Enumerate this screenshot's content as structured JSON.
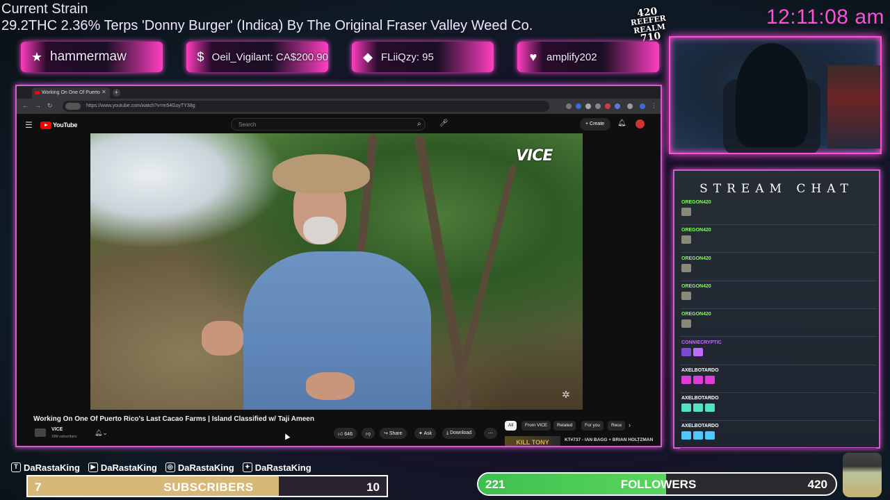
{
  "header": {
    "strain_title": "Current Strain",
    "strain_text": "29.2THC 2.36% Terps 'Donny Burger' (Indica) By The Original Fraser Valley Weed Co.",
    "clock": "12:11:08 am",
    "logo_text": "420 Reefer Realm 710"
  },
  "alerts": [
    {
      "icon": "star-icon",
      "glyph": "★",
      "text": "hammermaw"
    },
    {
      "icon": "dollar-icon",
      "glyph": "$",
      "text": "Oeil_Vigilant: CA$200.90"
    },
    {
      "icon": "diamond-icon",
      "glyph": "◆",
      "text": "FLiiQzy: 95"
    },
    {
      "icon": "heart-icon",
      "glyph": "♥",
      "text": "amplify202"
    }
  ],
  "browser": {
    "tab_title": "Working On One Of Puerto",
    "url": "https://www.youtube.com/watch?v=m54GoyTY38g",
    "yt_wordmark": "YouTube",
    "search_placeholder": "Search",
    "create_label": "+ Create",
    "watermark": "VICE",
    "video_title": "Working On One Of Puerto Rico's Last Cacao Farms | Island Classified w/ Taji Ameen",
    "channel_name": "VICE",
    "channel_subs": "18M subscribers",
    "likes": "646",
    "share_label": "Share",
    "ask_label": "Ask",
    "download_label": "Download",
    "chips": [
      {
        "label": "All",
        "active": true
      },
      {
        "label": "From VICE",
        "active": false
      },
      {
        "label": "Related",
        "active": false
      },
      {
        "label": "For you",
        "active": false
      },
      {
        "label": "Rece",
        "active": false
      }
    ],
    "rec_thumb_text": "KILL TONY",
    "rec_title": "KT#737 - IAN BAGG + BRIAN HOLTZMAN"
  },
  "chat": {
    "title": "STREAM CHAT",
    "messages": [
      {
        "user": "OREGON420",
        "color": "#7fff5a",
        "emotes": 1
      },
      {
        "user": "OREGON420",
        "color": "#7fff5a",
        "emotes": 1
      },
      {
        "user": "OREGON420",
        "color": "#7fff5a",
        "emotes": 1
      },
      {
        "user": "OREGON420",
        "color": "#7fff5a",
        "emotes": 1
      },
      {
        "user": "OREGON420",
        "color": "#7fff5a",
        "emotes": 1
      },
      {
        "user": "CONNIECRYPTIC",
        "color": "#c06cff",
        "emotes": 2
      },
      {
        "user": "AXELBOTARDO",
        "color": "#ffffff",
        "emotes": 3
      },
      {
        "user": "AXELBOTARDO",
        "color": "#ffffff",
        "emotes": 3
      },
      {
        "user": "AXELBOTARDO",
        "color": "#ffffff",
        "emotes": 3
      }
    ]
  },
  "socials": [
    {
      "icon": "twitch-icon",
      "glyph": "T",
      "handle": "DaRastaKing"
    },
    {
      "icon": "youtube-icon",
      "glyph": "▶",
      "handle": "DaRastaKing"
    },
    {
      "icon": "instagram-icon",
      "glyph": "◎",
      "handle": "DaRastaKing"
    },
    {
      "icon": "twitter-icon",
      "glyph": "✦",
      "handle": "DaRastaKing"
    }
  ],
  "subscribers": {
    "count": "7",
    "label": "SUBSCRIBERS",
    "goal": "10",
    "progress": 0.7
  },
  "followers": {
    "count": "221",
    "label": "FOLLOWERS",
    "goal": "420",
    "progress": 0.526
  },
  "colors": {
    "accent": "#ff4fd8",
    "frame": "#d65bd0",
    "follow_green": "#3fbf4f",
    "sub_gold": "#d8b877"
  }
}
